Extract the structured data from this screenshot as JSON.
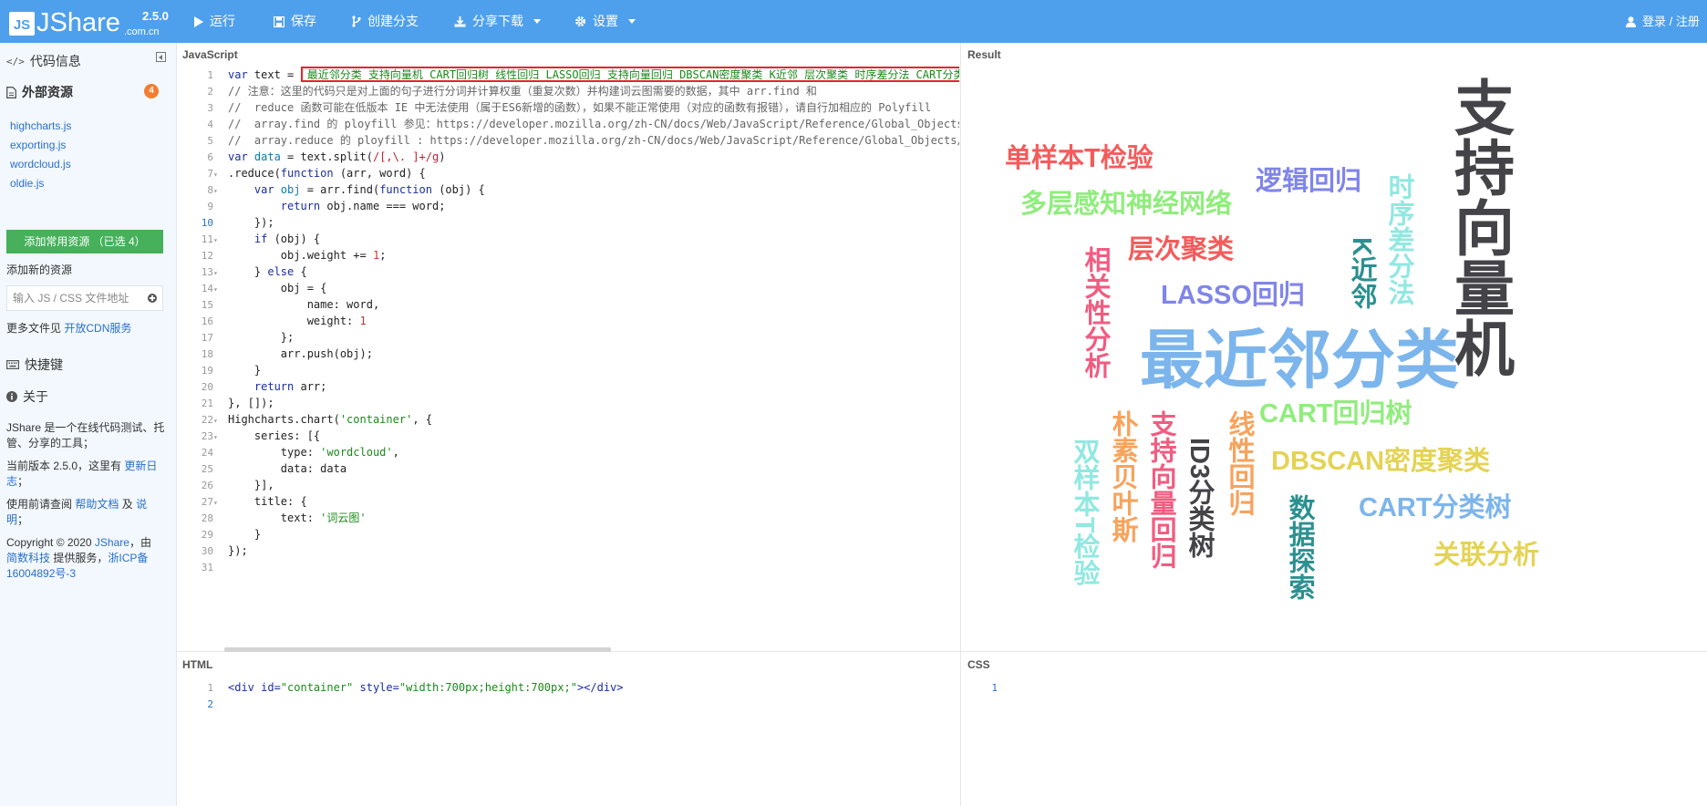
{
  "topbar": {
    "logo_js": "JS",
    "logo_word": "JShare",
    "logo_domain": ".com.cn",
    "version": "2.5.0",
    "buttons": [
      "运行",
      "保存",
      "创建分支",
      "分享下载",
      "设置"
    ],
    "login": "登录 / 注册"
  },
  "sidebar": {
    "code_info": "代码信息",
    "external": "外部资源",
    "external_count": "4",
    "resources": [
      "highcharts.js",
      "exporting.js",
      "wordcloud.js",
      "oldie.js"
    ],
    "add_common": "添加常用资源 （已选 4）",
    "add_new": "添加新的资源",
    "input_placeholder": "输入 JS / CSS 文件地址",
    "more_files_prefix": "更多文件见",
    "more_files_link": "开放CDN服务",
    "shortcuts": "快捷键",
    "about": "关于",
    "about_desc": "JShare 是一个在线代码测试、托管、分享的工具；",
    "version_prefix": "当前版本 2.5.0，这里有",
    "version_link": "更新日志",
    "version_suffix": "；",
    "help_prefix": "使用前请查阅",
    "help_link1": "帮助文档",
    "help_and": "及",
    "help_link2": "说明",
    "help_suffix": "；",
    "copyright_prefix": "Copyright © 2020",
    "copyright_link1": "JShare",
    "copyright_mid1": "，由",
    "copyright_link2": "简数科技",
    "copyright_mid2": "提供服务，",
    "copyright_link3": "浙ICP备16004892号-3"
  },
  "panels": {
    "javascript": "JavaScript",
    "result": "Result",
    "html": "HTML",
    "css": "CSS"
  },
  "js_code": {
    "l1_a": "var",
    "l1_b": " text = ",
    "l1_str": " 最近邻分类 支持向量机 CART回归树 线性回归 LASSO回归 支持向量回归 DBSCAN密度聚类 K近邻 层次聚类 时序差分法 CART分类",
    "l2": "// 注意：这里的代码只是对上面的句子进行分词并计算权重（重复次数）并构建词云图需要的数据，其中 arr.find 和",
    "l3": "//  reduce 函数可能在低版本 IE 中无法使用（属于ES6新增的函数），如果不能正常使用（对应的函数有报错），请自行加相应的 Polyfill",
    "l4": "//  array.find 的 ployfill 参见：https://developer.mozilla.org/zh-CN/docs/Web/JavaScript/Reference/Global_Objects/",
    "l5": "//  array.reduce 的 ployfill : https://developer.mozilla.org/zh-CN/docs/Web/JavaScript/Reference/Global_Objects/",
    "l6_a": "var",
    "l6_b": " data",
    "l6_c": " = text.split(",
    "l6_rx": "/[,\\. ]+/g",
    "l6_d": ")",
    "l7_a": ".reduce(",
    "l7_b": "function",
    "l7_c": " (arr, word) {",
    "l8_a": "    var",
    "l8_b": " obj",
    "l8_c": " = arr.find(",
    "l8_d": "function",
    "l8_e": " (obj) {",
    "l9_a": "        return",
    "l9_b": " obj.name === word;",
    "l10": "    });",
    "l11_a": "    if",
    "l11_b": " (obj) {",
    "l12_a": "        obj.weight += ",
    "l12_b": "1",
    "l12_c": ";",
    "l13_a": "    } ",
    "l13_b": "else",
    "l13_c": " {",
    "l14": "        obj = {",
    "l15": "            name: word,",
    "l16_a": "            weight: ",
    "l16_b": "1",
    "l17": "        };",
    "l18": "        arr.push(obj);",
    "l19": "    }",
    "l20_a": "    return",
    "l20_b": " arr;",
    "l21": "}, []);",
    "l22_a": "Highcharts.chart(",
    "l22_b": "'container'",
    "l22_c": ", {",
    "l23": "    series: [{",
    "l24_a": "        type: ",
    "l24_b": "'wordcloud'",
    "l24_c": ",",
    "l25": "        data: data",
    "l26": "    }],",
    "l27": "    title: {",
    "l28_a": "        text: ",
    "l28_b": "'词云图'",
    "l29": "    }",
    "l30": "});"
  },
  "html_code": {
    "a": "<div id=",
    "b": "\"container\"",
    "c": " style=",
    "d": "\"width:700px;height:700px;\"",
    "e": "></div>"
  },
  "chart_data": {
    "type": "wordcloud",
    "title": "",
    "words": [
      {
        "text": "支持向量机",
        "color": "#434348"
      },
      {
        "text": "最近邻分类",
        "color": "#7cb5ec"
      },
      {
        "text": "单样本T检验",
        "color": "#f45b5b"
      },
      {
        "text": "逻辑回归",
        "color": "#8085e9"
      },
      {
        "text": "多层感知神经网络",
        "color": "#90ed7d"
      },
      {
        "text": "时序差分法",
        "color": "#91e8e1"
      },
      {
        "text": "层次聚类",
        "color": "#f45b5b"
      },
      {
        "text": "K近邻",
        "color": "#2b908f"
      },
      {
        "text": "相关性分析",
        "color": "#f15c80"
      },
      {
        "text": "LASSO回归",
        "color": "#8085e9"
      },
      {
        "text": "CART回归树",
        "color": "#90ed7d"
      },
      {
        "text": "线性回归",
        "color": "#f7a35c"
      },
      {
        "text": "朴素贝叶斯",
        "color": "#f7a35c"
      },
      {
        "text": "支持向量回归",
        "color": "#f15c80"
      },
      {
        "text": "ID3分类树",
        "color": "#434348"
      },
      {
        "text": "DBSCAN密度聚类",
        "color": "#e4d354"
      },
      {
        "text": "双样本T检验",
        "color": "#91e8e1"
      },
      {
        "text": "数据探索",
        "color": "#2b908f"
      },
      {
        "text": "CART分类树",
        "color": "#7cb5ec"
      },
      {
        "text": "关联分析",
        "color": "#e4d354"
      }
    ]
  }
}
